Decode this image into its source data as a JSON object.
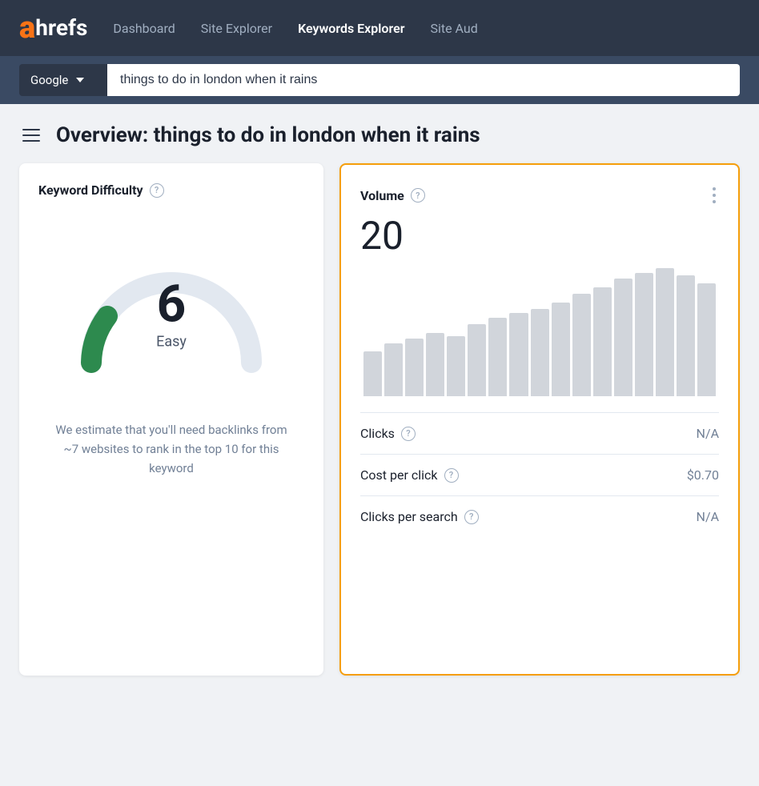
{
  "nav": {
    "logo_a": "a",
    "logo_hrefs": "hrefs",
    "links": [
      {
        "id": "dashboard",
        "label": "Dashboard",
        "active": false
      },
      {
        "id": "site-explorer",
        "label": "Site Explorer",
        "active": false
      },
      {
        "id": "keywords-explorer",
        "label": "Keywords Explorer",
        "active": true
      },
      {
        "id": "site-audit",
        "label": "Site Aud",
        "active": false
      }
    ]
  },
  "search": {
    "engine": "Google",
    "query": "things to do in london when it rains"
  },
  "page": {
    "title": "Overview: things to do in london when it rains"
  },
  "kd_card": {
    "title": "Keyword Difficulty",
    "help": "?",
    "score": "6",
    "label": "Easy",
    "description": "We estimate that you'll need backlinks from ~7 websites to rank in the top 10 for this keyword"
  },
  "volume_card": {
    "title": "Volume",
    "help": "?",
    "value": "20",
    "bars": [
      30,
      35,
      38,
      42,
      40,
      48,
      52,
      55,
      58,
      62,
      68,
      72,
      78,
      82,
      85,
      80,
      75
    ],
    "stats": [
      {
        "id": "clicks",
        "label": "Clicks",
        "value": "N/A"
      },
      {
        "id": "cpc",
        "label": "Cost per click",
        "value": "$0.70"
      },
      {
        "id": "clicks-per-search",
        "label": "Clicks per search",
        "value": "N/A"
      }
    ]
  },
  "colors": {
    "nav_bg": "#2d3748",
    "accent_orange": "#f97316",
    "card_border_gold": "#f59e0b",
    "gauge_green": "#2d8a4e",
    "gauge_bg": "#e2e8f0"
  }
}
